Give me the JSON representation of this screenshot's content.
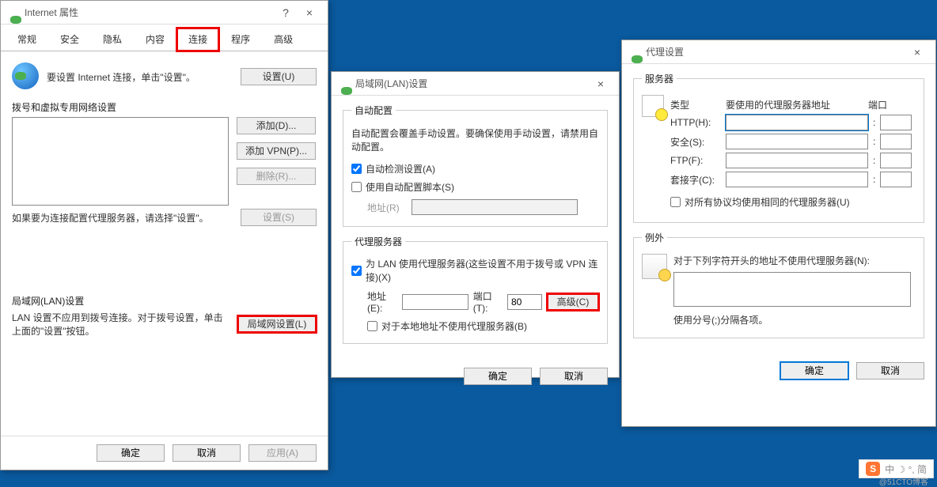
{
  "dlg1": {
    "title": "Internet 属性",
    "help": "?",
    "close": "×",
    "tabs": [
      "常规",
      "安全",
      "隐私",
      "内容",
      "连接",
      "程序",
      "高级"
    ],
    "active_tab": 4,
    "intro": "要设置 Internet 连接，单击\"设置\"。",
    "btn_setup": "设置(U)",
    "group_dial": "拨号和虚拟专用网络设置",
    "btn_add": "添加(D)...",
    "btn_add_vpn": "添加 VPN(P)...",
    "btn_del": "删除(R)...",
    "proxy_hint": "如果要为连接配置代理服务器，请选择\"设置\"。",
    "btn_settings": "设置(S)",
    "group_lan": "局域网(LAN)设置",
    "lan_hint": "LAN 设置不应用到拨号连接。对于拨号设置，单击上面的\"设置\"按钮。",
    "btn_lan": "局域网设置(L)",
    "ok": "确定",
    "cancel": "取消",
    "apply": "应用(A)"
  },
  "dlg2": {
    "title": "局域网(LAN)设置",
    "close": "×",
    "fs_auto": "自动配置",
    "auto_hint": "自动配置会覆盖手动设置。要确保使用手动设置，请禁用自动配置。",
    "cb_detect": "自动检测设置(A)",
    "cb_script": "使用自动配置脚本(S)",
    "lbl_addr_r": "地址(R)",
    "fs_proxy": "代理服务器",
    "cb_useproxy": "为 LAN 使用代理服务器(这些设置不用于拨号或 VPN 连接)(X)",
    "lbl_addr_e": "地址(E):",
    "lbl_port_t": "端口(T):",
    "port_val": "80",
    "btn_adv": "高级(C)",
    "cb_bypass": "对于本地地址不使用代理服务器(B)",
    "ok": "确定",
    "cancel": "取消"
  },
  "dlg3": {
    "title": "代理设置",
    "close": "×",
    "fs_servers": "服务器",
    "hdr_type": "类型",
    "hdr_addr": "要使用的代理服务器地址",
    "hdr_port": "端口",
    "lbl_http": "HTTP(H):",
    "lbl_secure": "安全(S):",
    "lbl_ftp": "FTP(F):",
    "lbl_socks": "套接字(C):",
    "cb_same": "对所有协议均使用相同的代理服务器(U)",
    "fs_except": "例外",
    "except_hint": "对于下列字符开头的地址不使用代理服务器(N):",
    "except_note": "使用分号(;)分隔各项。",
    "ok": "确定",
    "cancel": "取消"
  },
  "watermark": {
    "text": "中 ☽ °, 简",
    "sub": "@51CTO博客"
  }
}
